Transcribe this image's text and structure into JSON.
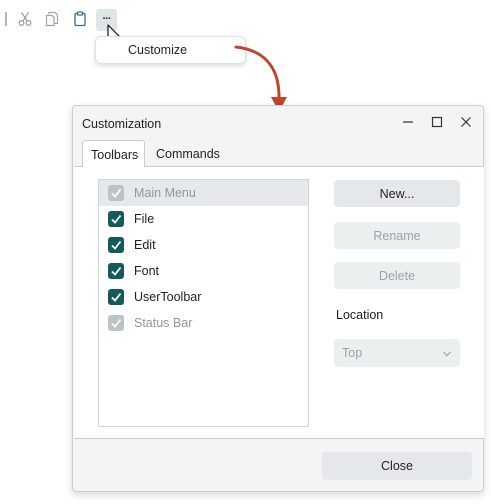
{
  "toolbar": {
    "icons": [
      "scissors-icon",
      "copy-icon",
      "clipboard-icon",
      "more-icon"
    ],
    "more_label": "···"
  },
  "popup": {
    "item_label": "Customize"
  },
  "dialog": {
    "title": "Customization",
    "tabs": [
      {
        "label": "Toolbars",
        "active": true
      },
      {
        "label": "Commands",
        "active": false
      }
    ],
    "toolbars_list": [
      {
        "label": "Main Menu",
        "checked": true,
        "enabled": false,
        "selected": true
      },
      {
        "label": "File",
        "checked": true,
        "enabled": true,
        "selected": false
      },
      {
        "label": "Edit",
        "checked": true,
        "enabled": true,
        "selected": false
      },
      {
        "label": "Font",
        "checked": true,
        "enabled": true,
        "selected": false
      },
      {
        "label": "UserToolbar",
        "checked": true,
        "enabled": true,
        "selected": false
      },
      {
        "label": "Status Bar",
        "checked": true,
        "enabled": false,
        "selected": false
      }
    ],
    "buttons": {
      "new_label": "New...",
      "rename_label": "Rename",
      "delete_label": "Delete"
    },
    "location": {
      "label": "Location",
      "value": "Top"
    },
    "close_label": "Close"
  },
  "colors": {
    "accent": "#135a5c",
    "arrow": "#c0452b",
    "checkbox_disabled": "#bcc3c5"
  }
}
